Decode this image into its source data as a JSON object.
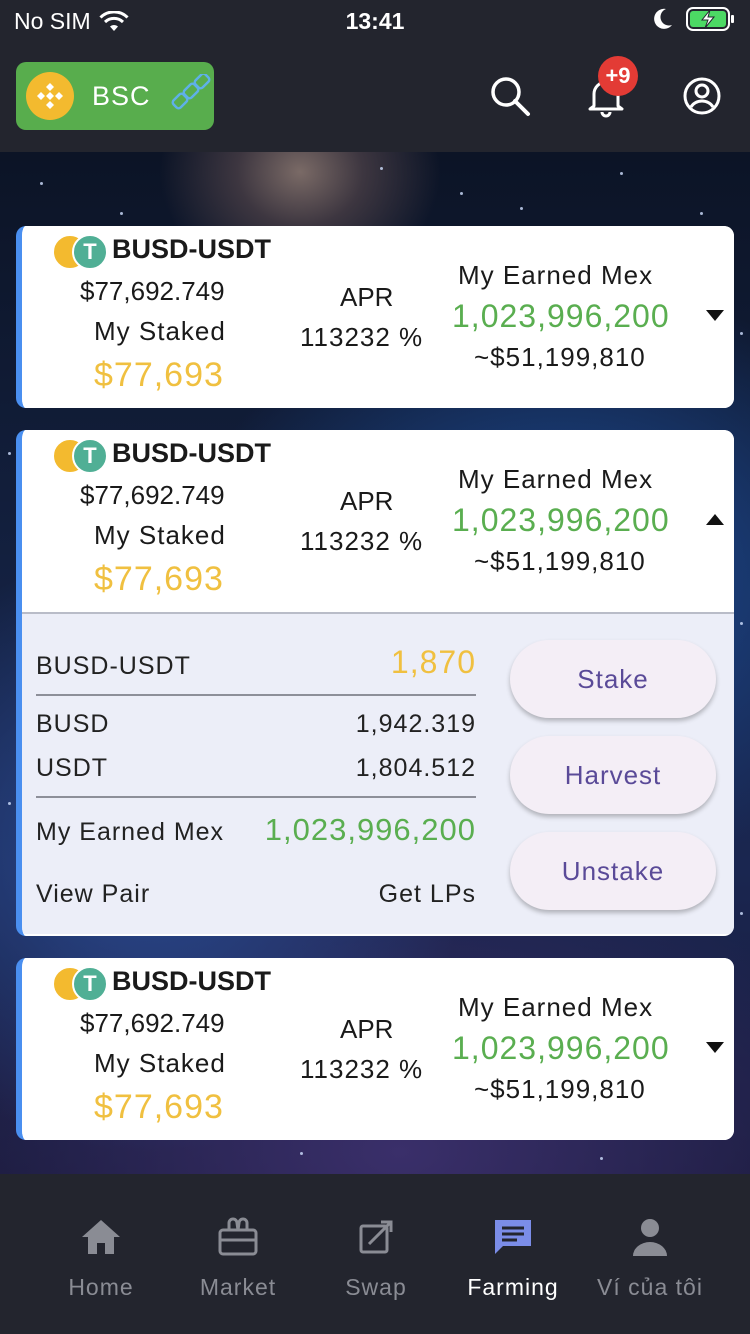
{
  "status_bar": {
    "carrier": "No SIM",
    "time": "13:41"
  },
  "header": {
    "network_label": "BSC",
    "notification_count": "+9"
  },
  "farms": [
    {
      "pair": "BUSD-USDT",
      "liquidity": "$77,692.749",
      "staked_label": "My Staked",
      "staked_value": "$77,693",
      "apr_label": "APR",
      "apr_value": "113232 %",
      "earned_label": "My Earned Mex",
      "earned_value": "1,023,996,200",
      "earned_usd": "~$51,199,810",
      "expanded": false
    },
    {
      "pair": "BUSD-USDT",
      "liquidity": "$77,692.749",
      "staked_label": "My Staked",
      "staked_value": "$77,693",
      "apr_label": "APR",
      "apr_value": "113232 %",
      "earned_label": "My Earned Mex",
      "earned_value": "1,023,996,200",
      "earned_usd": "~$51,199,810",
      "expanded": true
    },
    {
      "pair": "BUSD-USDT",
      "liquidity": "$77,692.749",
      "staked_label": "My Staked",
      "staked_value": "$77,693",
      "apr_label": "APR",
      "apr_value": "113232 %",
      "earned_label": "My Earned Mex",
      "earned_value": "1,023,996,200",
      "earned_usd": "~$51,199,810",
      "expanded": false
    }
  ],
  "detail": {
    "lp_label": "BUSD-USDT",
    "lp_value": "1,870",
    "token_a_label": "BUSD",
    "token_a_value": "1,942.319",
    "token_b_label": "USDT",
    "token_b_value": "1,804.512",
    "earned_label": "My Earned Mex",
    "earned_value": "1,023,996,200",
    "view_pair": "View Pair",
    "get_lps": "Get LPs",
    "stake_button": "Stake",
    "harvest_button": "Harvest",
    "unstake_button": "Unstake"
  },
  "tabs": [
    {
      "label": "Home",
      "icon": "home-icon",
      "active": false
    },
    {
      "label": "Market",
      "icon": "market-icon",
      "active": false
    },
    {
      "label": "Swap",
      "icon": "swap-icon",
      "active": false
    },
    {
      "label": "Farming",
      "icon": "farming-icon",
      "active": true
    },
    {
      "label": "Ví của tôi",
      "icon": "user-icon",
      "active": false
    }
  ],
  "colors": {
    "accent_green": "#5aae50",
    "staked_yellow": "#f0c040",
    "card_border": "#4a8ff0",
    "bsc_button": "#58ad4d",
    "badge_red": "#e33b35"
  }
}
